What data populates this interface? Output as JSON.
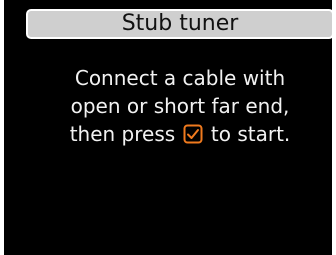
{
  "header": {
    "title": "Stub tuner"
  },
  "message": {
    "line1": "Connect a cable with",
    "line2": "open or short far end,",
    "line3_before_icon": "then press",
    "line3_icon": "checkbox-checked-icon",
    "line3_after_icon": "to start."
  },
  "colors": {
    "screen_background": "#000000",
    "title_bar_background": "#cfcfcf",
    "title_bar_border": "#ffffff",
    "text": "#f2f2f2",
    "accent": "#f07a1e"
  }
}
